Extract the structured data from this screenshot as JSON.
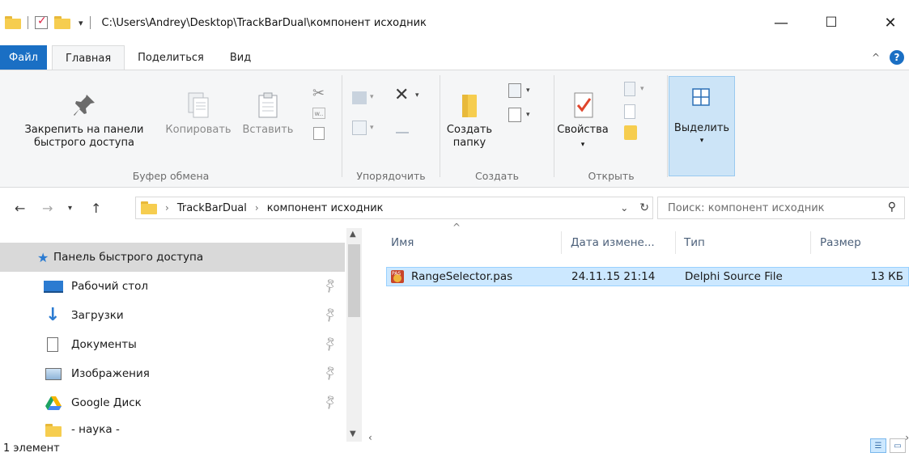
{
  "titlebar": {
    "path": "C:\\Users\\Andrey\\Desktop\\TrackBarDual\\компонент исходник",
    "minimize": "—",
    "maximize": "☐",
    "close": "✕"
  },
  "tabs": {
    "file": "Файл",
    "home": "Главная",
    "share": "Поделиться",
    "view": "Вид"
  },
  "ribbon": {
    "pin_line1": "Закрепить на панели",
    "pin_line2": "быстрого доступа",
    "copy": "Копировать",
    "paste": "Вставить",
    "clipboard_group": "Буфер обмена",
    "organize_group": "Упорядочить",
    "new_folder_line1": "Создать",
    "new_folder_line2": "папку",
    "create_group": "Создать",
    "properties": "Свойства",
    "open_group": "Открыть",
    "select": "Выделить"
  },
  "address": {
    "crumb1": "TrackBarDual",
    "crumb2": "компонент исходник",
    "search_placeholder": "Поиск: компонент исходник"
  },
  "navpane": {
    "items": [
      {
        "label": "Панель быстрого доступа"
      },
      {
        "label": "Рабочий стол"
      },
      {
        "label": "Загрузки"
      },
      {
        "label": "Документы"
      },
      {
        "label": "Изображения"
      },
      {
        "label": "Google Диск"
      },
      {
        "label": "- наука -"
      }
    ]
  },
  "columns": {
    "name": "Имя",
    "date": "Дата измене...",
    "type": "Тип",
    "size": "Размер"
  },
  "files": [
    {
      "name": "RangeSelector.pas",
      "date": "24.11.15 21:14",
      "type": "Delphi Source File",
      "size": "13 КБ"
    }
  ],
  "status": {
    "count": "1 элемент"
  },
  "colors": {
    "accent": "#1a6fc4",
    "selection": "#cce8ff",
    "folder": "#f6cd4f"
  }
}
